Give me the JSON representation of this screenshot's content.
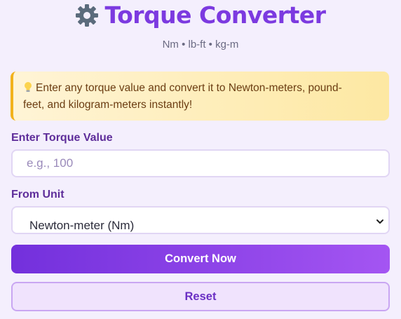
{
  "header": {
    "icon": "gear-icon",
    "title": "Torque Converter",
    "subtitle": "Nm • lb-ft • kg-m"
  },
  "tip": {
    "icon": "lightbulb-icon",
    "line1": "Enter any torque value and convert it to Newton-meters, pound-",
    "line2": "feet, and kilogram-meters instantly!"
  },
  "form": {
    "value_label": "Enter Torque Value",
    "value_placeholder": "e.g., 100",
    "value": "",
    "unit_label": "From Unit",
    "unit_selected": "Newton-meter (Nm)"
  },
  "buttons": {
    "convert": "Convert Now",
    "reset": "Reset"
  },
  "colors": {
    "accent": "#7c3ae0",
    "button_gradient_start": "#7330dc",
    "button_gradient_end": "#a455f2",
    "tip_border": "#f2b21c",
    "background": "#f4effd"
  }
}
